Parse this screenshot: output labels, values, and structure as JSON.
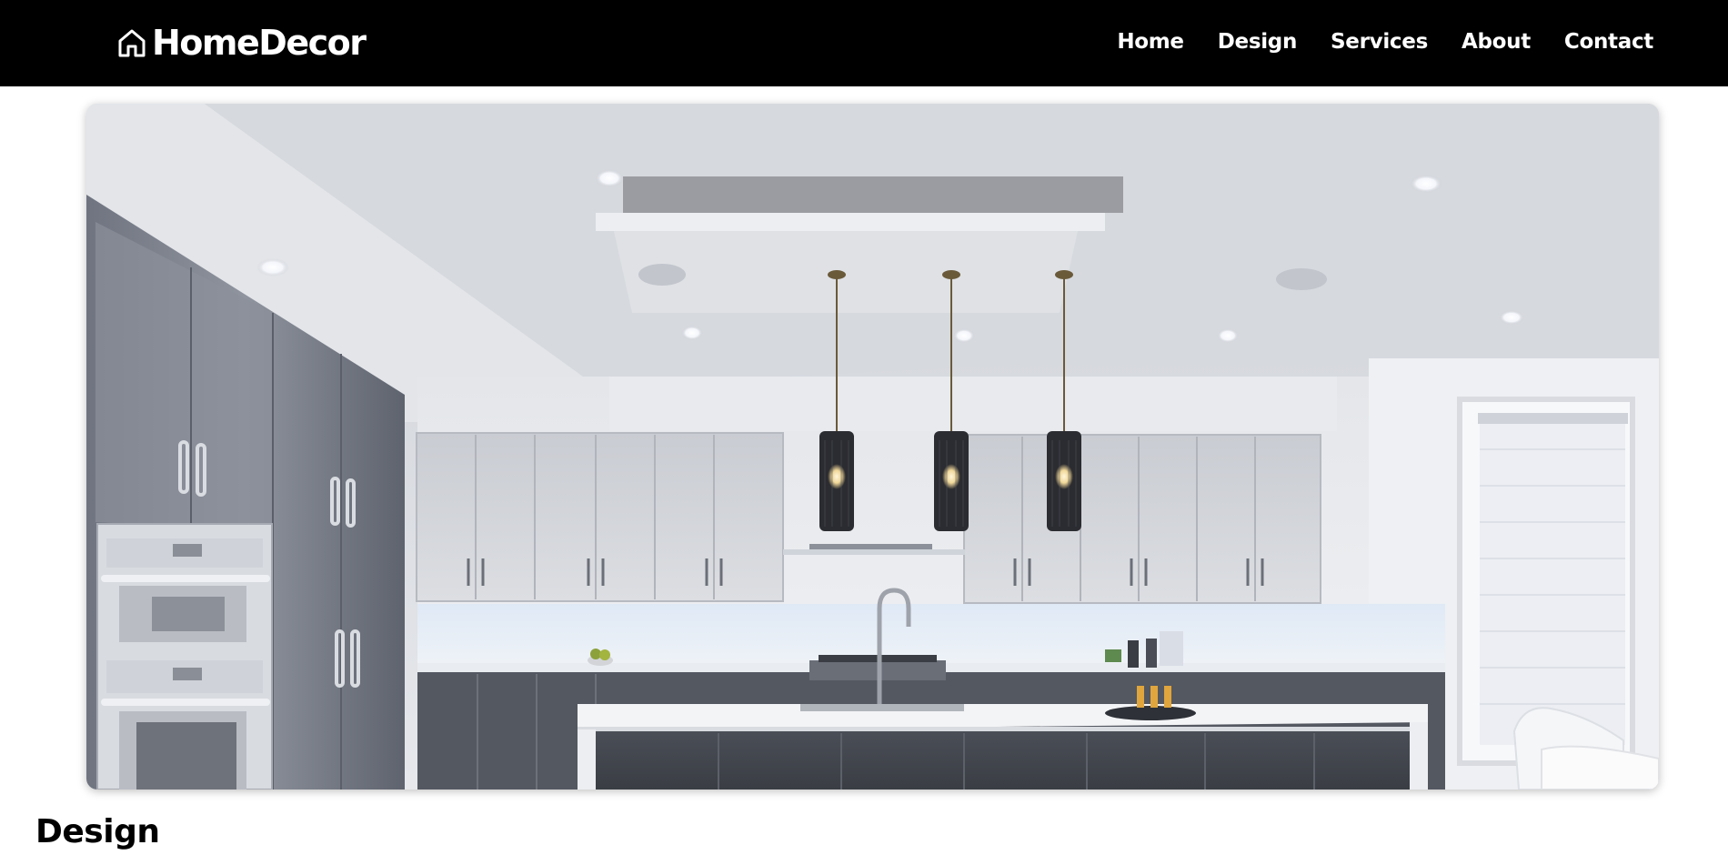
{
  "navbar": {
    "brand": "HomeDecor",
    "brand_icon": "house-outline-icon",
    "background_color": "#000000",
    "links": [
      {
        "label": "Home"
      },
      {
        "label": "Design"
      },
      {
        "label": "Services"
      },
      {
        "label": "About"
      },
      {
        "label": "Contact"
      }
    ]
  },
  "hero": {
    "image_subject": "modern-kitchen-photo"
  },
  "section": {
    "heading": "Design"
  }
}
